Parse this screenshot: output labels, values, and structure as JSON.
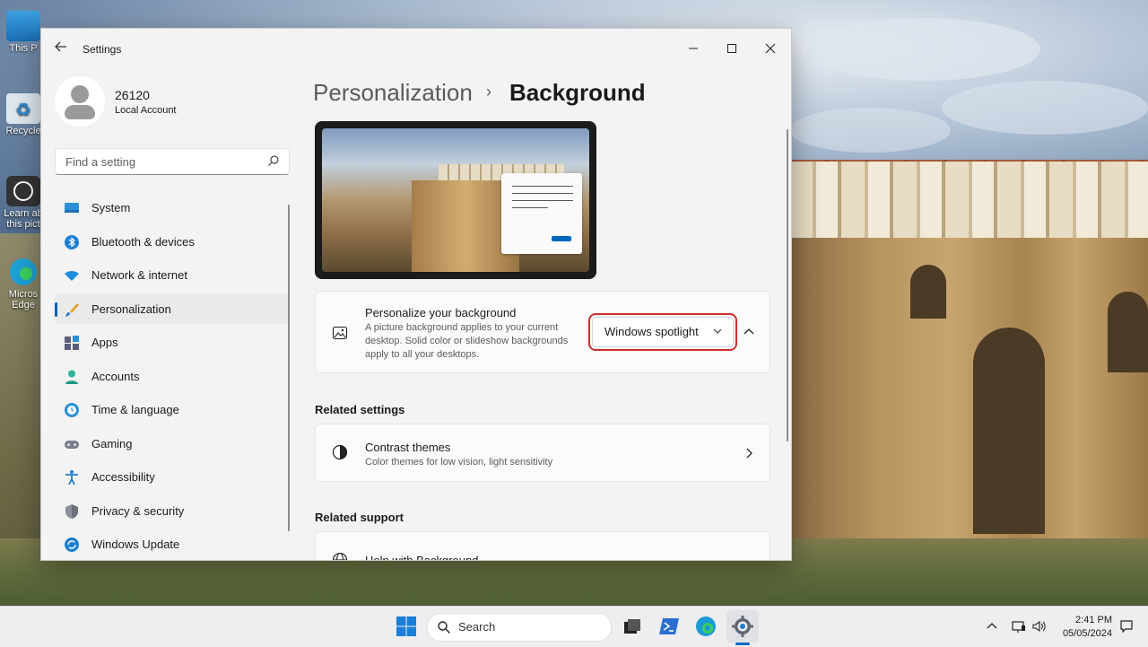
{
  "desktop": {
    "icons": [
      {
        "label": "This P"
      },
      {
        "label": "Recycle"
      },
      {
        "label": "Learn ab this pict"
      },
      {
        "label": "Micros Edge"
      }
    ]
  },
  "window": {
    "title": "Settings",
    "controls": {
      "minimize": "—",
      "maximize": "☐",
      "close": "✕"
    }
  },
  "user": {
    "name": "26120",
    "account_type": "Local Account"
  },
  "search": {
    "placeholder": "Find a setting"
  },
  "sidebar": {
    "items": [
      {
        "label": "System",
        "icon": "system-icon"
      },
      {
        "label": "Bluetooth & devices",
        "icon": "bluetooth-icon"
      },
      {
        "label": "Network & internet",
        "icon": "wifi-icon"
      },
      {
        "label": "Personalization",
        "icon": "brush-icon",
        "active": true
      },
      {
        "label": "Apps",
        "icon": "apps-icon"
      },
      {
        "label": "Accounts",
        "icon": "accounts-icon"
      },
      {
        "label": "Time & language",
        "icon": "clock-icon"
      },
      {
        "label": "Gaming",
        "icon": "gamepad-icon"
      },
      {
        "label": "Accessibility",
        "icon": "accessibility-icon"
      },
      {
        "label": "Privacy & security",
        "icon": "shield-icon"
      },
      {
        "label": "Windows Update",
        "icon": "update-icon"
      }
    ]
  },
  "breadcrumb": {
    "parent": "Personalization",
    "separator": "›",
    "current": "Background"
  },
  "personalize": {
    "title": "Personalize your background",
    "description": "A picture background applies to your current desktop. Solid color or slideshow backgrounds apply to all your desktops.",
    "dropdown_value": "Windows spotlight"
  },
  "related_settings": {
    "heading": "Related settings",
    "contrast": {
      "title": "Contrast themes",
      "description": "Color themes for low vision, light sensitivity"
    }
  },
  "related_support": {
    "heading": "Related support",
    "help": {
      "title": "Help with Background"
    }
  },
  "taskbar": {
    "search_label": "Search",
    "time": "2:41 PM",
    "date": "05/05/2024"
  },
  "colors": {
    "accent": "#005fb8",
    "highlight_outline": "#d12d2d"
  }
}
